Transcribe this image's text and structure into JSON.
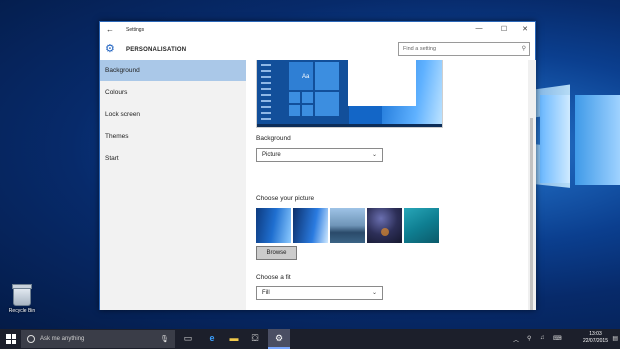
{
  "desktop": {
    "recycle_bin_label": "Recycle Bin"
  },
  "window": {
    "title": "Settings",
    "back_icon": "back-arrow-icon",
    "controls": {
      "minimize": "—",
      "maximize": "☐",
      "close": "✕"
    },
    "header_icon": "gear-icon",
    "page_title": "PERSONALISATION",
    "search": {
      "placeholder": "Find a setting",
      "icon": "search-icon"
    }
  },
  "sidebar": {
    "items": [
      {
        "label": "Background",
        "active": true
      },
      {
        "label": "Colours",
        "active": false
      },
      {
        "label": "Lock screen",
        "active": false
      },
      {
        "label": "Themes",
        "active": false
      },
      {
        "label": "Start",
        "active": false
      }
    ]
  },
  "content": {
    "preview_tile_text": "Aa",
    "background_label": "Background",
    "background_value": "Picture",
    "choose_picture_label": "Choose your picture",
    "browse_label": "Browse",
    "fit_label": "Choose a fit",
    "fit_value": "Fill"
  },
  "taskbar": {
    "search_placeholder": "Ask me anything",
    "apps": [
      "task-view-icon",
      "edge-icon",
      "file-explorer-icon",
      "store-icon",
      "settings-icon"
    ],
    "active_app": "settings-icon",
    "clock": {
      "time": "13:03",
      "date": "22/07/2015"
    }
  },
  "colors": {
    "accent": "#1b5fbf",
    "nav_selected": "#aac8e8",
    "taskbar": "#1c1f2b"
  }
}
